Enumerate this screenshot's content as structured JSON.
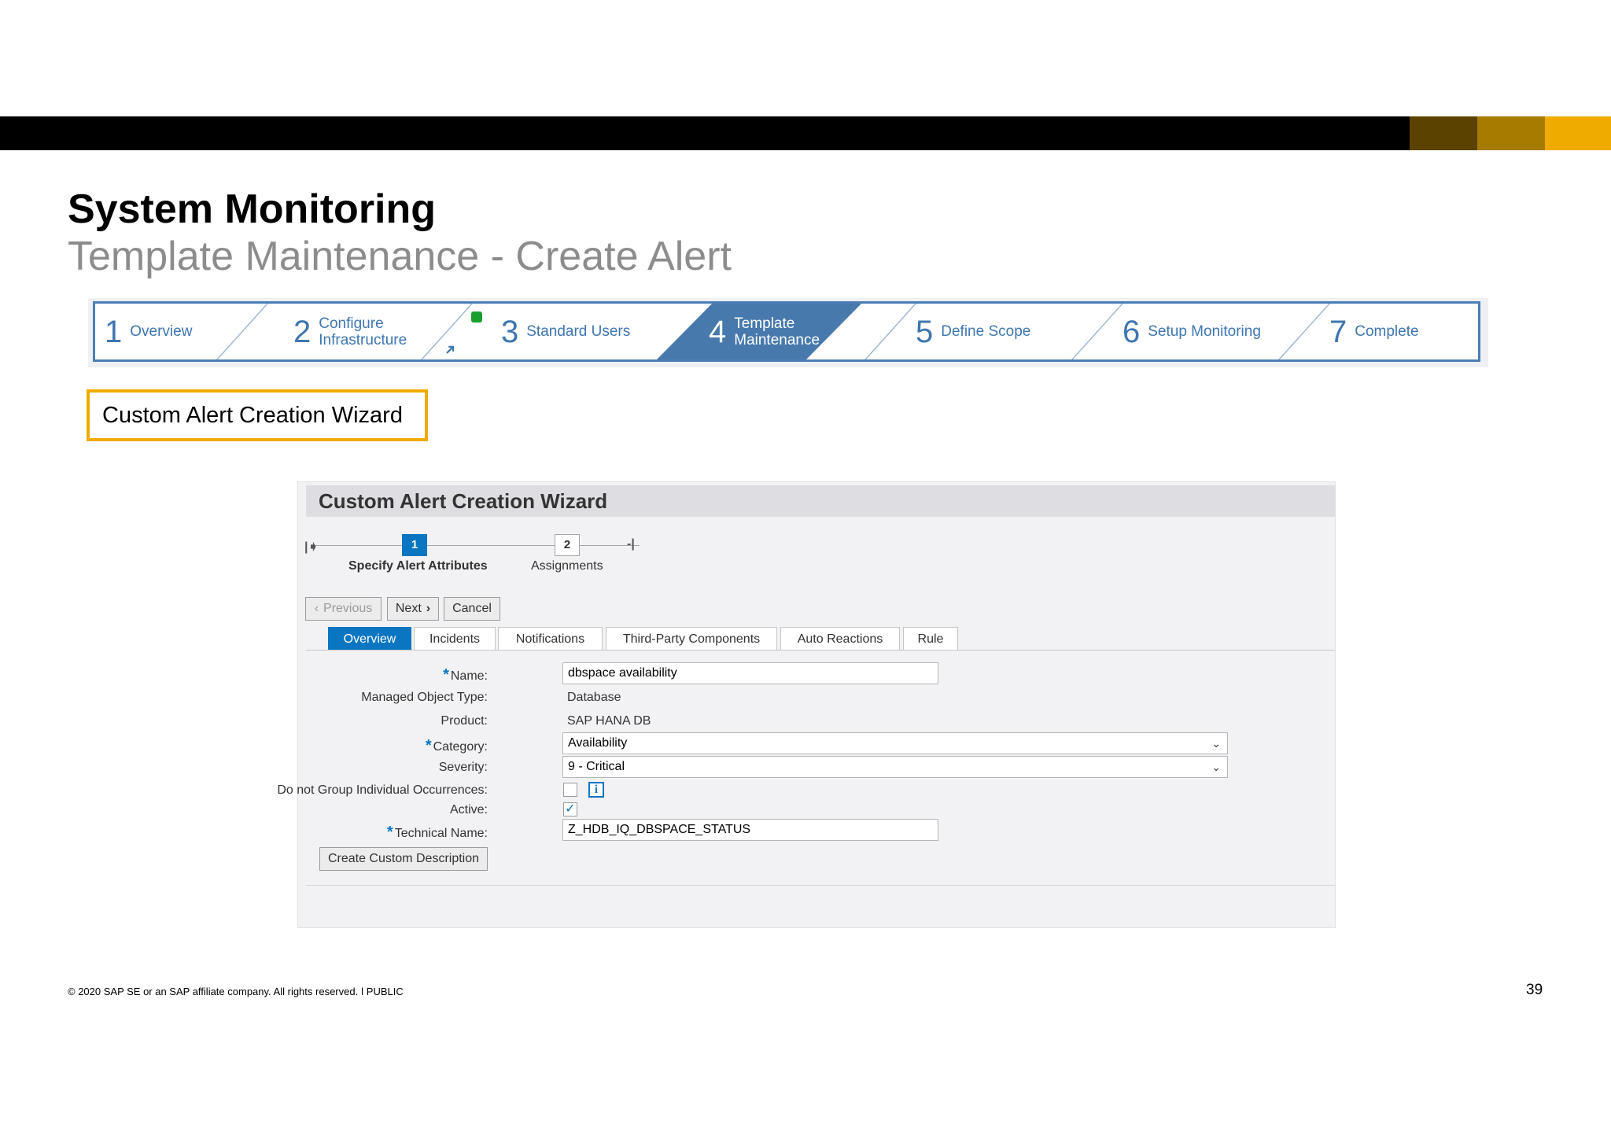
{
  "slide": {
    "title": "System Monitoring",
    "subtitle": "Template Maintenance - Create Alert",
    "callout": "Custom Alert Creation Wizard",
    "footer": "© 2020 SAP SE or an SAP affiliate company. All rights reserved.  ǀ   PUBLIC",
    "page_number": "39",
    "colors": {
      "accent": "#f0ab00",
      "bar": "#000000",
      "roadmap_active": "#4779ad",
      "sap_blue": "#0a76c2"
    }
  },
  "roadmap": {
    "steps": [
      {
        "num": "1",
        "label1": "Overview",
        "label2": ""
      },
      {
        "num": "2",
        "label1": "Configure",
        "label2": "Infrastructure"
      },
      {
        "num": "3",
        "label1": "Standard Users",
        "label2": ""
      },
      {
        "num": "4",
        "label1": "Template",
        "label2": "Maintenance"
      },
      {
        "num": "5",
        "label1": "Define Scope",
        "label2": ""
      },
      {
        "num": "6",
        "label1": "Setup Monitoring",
        "label2": ""
      },
      {
        "num": "7",
        "label1": "Complete",
        "label2": ""
      }
    ],
    "active_step": "4"
  },
  "wizard": {
    "header": "Custom Alert Creation Wizard",
    "train": [
      {
        "num": "1",
        "label": "Specify Alert Attributes"
      },
      {
        "num": "2",
        "label": "Assignments"
      }
    ],
    "buttons": {
      "previous": "Previous",
      "next": "Next",
      "cancel": "Cancel",
      "create_description": "Create Custom Description"
    },
    "tabs": [
      "Overview",
      "Incidents",
      "Notifications",
      "Third-Party Components",
      "Auto Reactions",
      "Rule"
    ],
    "active_tab": "Overview",
    "form": {
      "name_label": "Name:",
      "name_value": "dbspace availability",
      "mot_label": "Managed Object Type:",
      "mot_value": "Database",
      "product_label": "Product:",
      "product_value": "SAP HANA DB",
      "category_label": "Category:",
      "category_value": "Availability",
      "severity_label": "Severity:",
      "severity_value": "9 - Critical",
      "group_label": "Do not Group Individual Occurrences:",
      "group_checked": false,
      "active_label": "Active:",
      "active_checked": true,
      "tech_label": "Technical Name:",
      "tech_value": "Z_HDB_IQ_DBSPACE_STATUS"
    }
  }
}
